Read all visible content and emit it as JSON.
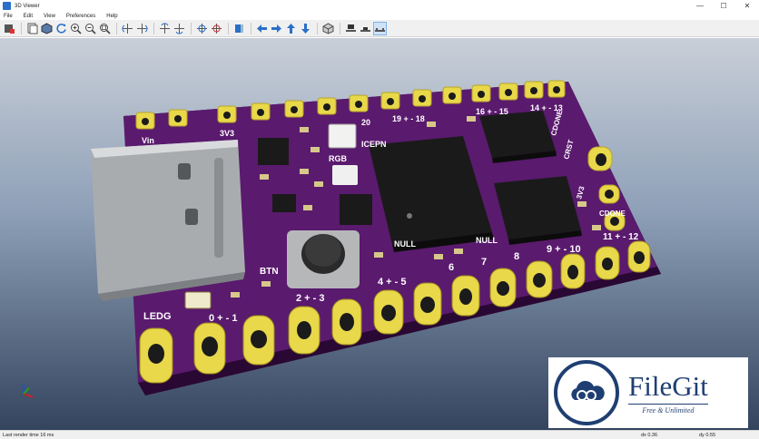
{
  "window": {
    "title": "3D Viewer",
    "minimize_glyph": "—",
    "maximize_glyph": "☐",
    "close_glyph": "✕"
  },
  "menu": [
    "File",
    "Edit",
    "View",
    "Preferences",
    "Help"
  ],
  "toolbar": {
    "icons": [
      "render-mode-icon",
      "copy-image-icon",
      "board-body-icon",
      "refresh-icon",
      "zoom-in-icon",
      "zoom-out-icon",
      "zoom-fit-icon",
      "rotate-x-cw-icon",
      "rotate-x-ccw-icon",
      "rotate-y-cw-icon",
      "rotate-y-ccw-icon",
      "rotate-z-cw-icon",
      "rotate-z-ccw-icon",
      "flip-board-icon",
      "pan-left-icon",
      "pan-right-icon",
      "pan-up-icon",
      "pan-down-icon",
      "orthographic-icon",
      "layers-top-icon",
      "layers-mid-icon",
      "layers-bottom-icon"
    ],
    "active": "layers-bottom-icon"
  },
  "board": {
    "silkscreen": [
      "Vin",
      "3V3",
      "20",
      "19 + - 18",
      "16 + - 15",
      "14 + - 13",
      "CDONE",
      "CRST",
      "3V3",
      "RGB",
      "ICEPN",
      "NULL",
      "NULL",
      "BTN",
      "LEDG",
      "0 + - 1",
      "2 + - 3",
      "4 + - 5",
      "6",
      "7",
      "8",
      "9 + - 10",
      "11 + - 12",
      "CDONE"
    ],
    "colors": {
      "pcb": "#5a1a6e",
      "pad": "#e8d84a",
      "silk": "#ffffff",
      "chip": "#1a1a1a",
      "usb": "#c4c6c8"
    }
  },
  "status": {
    "render_time": "Last render time 16 ms",
    "dx": "dx 0.36",
    "dy": "dy 0.55"
  },
  "watermark": {
    "name": "FileGit",
    "tagline": "Free & Unlimited"
  }
}
